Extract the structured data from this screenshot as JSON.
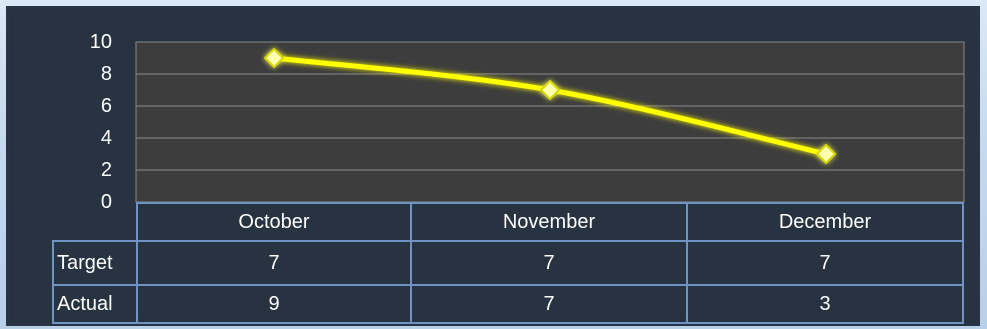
{
  "chart_data": {
    "type": "line",
    "categories": [
      "October",
      "November",
      "December"
    ],
    "series": [
      {
        "name": "Target",
        "values": [
          7,
          7,
          7
        ],
        "color": "#9fb8d8",
        "style": "dashed"
      },
      {
        "name": "Actual",
        "values": [
          9,
          7,
          3
        ],
        "color": "#ffff00",
        "style": "solid-with-diamond-markers"
      }
    ],
    "ylim": [
      0,
      10
    ],
    "yticks": [
      "0",
      "2",
      "4",
      "6",
      "8",
      "10"
    ],
    "grid": true,
    "legend": "data table below chart"
  },
  "colors": {
    "background": "#283341",
    "plot_area": "#3d3d3d",
    "table_border": "#6f93c2",
    "actual_line": "#ffff00",
    "target_line": "#9fb8d8"
  }
}
